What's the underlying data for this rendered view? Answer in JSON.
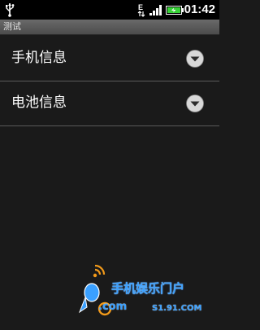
{
  "status_bar": {
    "time": "01:42",
    "network_indicator": "E",
    "icons": [
      "usb-icon",
      "edge-network-icon",
      "signal-icon",
      "battery-charging-icon"
    ],
    "battery_color": "#37d237"
  },
  "title_bar": {
    "title": "测试"
  },
  "list": {
    "items": [
      {
        "label": "手机信息",
        "icon": "chevron-down-icon"
      },
      {
        "label": "电池信息",
        "icon": "chevron-down-icon"
      }
    ]
  },
  "watermark": {
    "brand": "手机娱乐门户",
    "com": ".com",
    "url": "S1.91.COM",
    "accent": "#3aa0ff"
  }
}
